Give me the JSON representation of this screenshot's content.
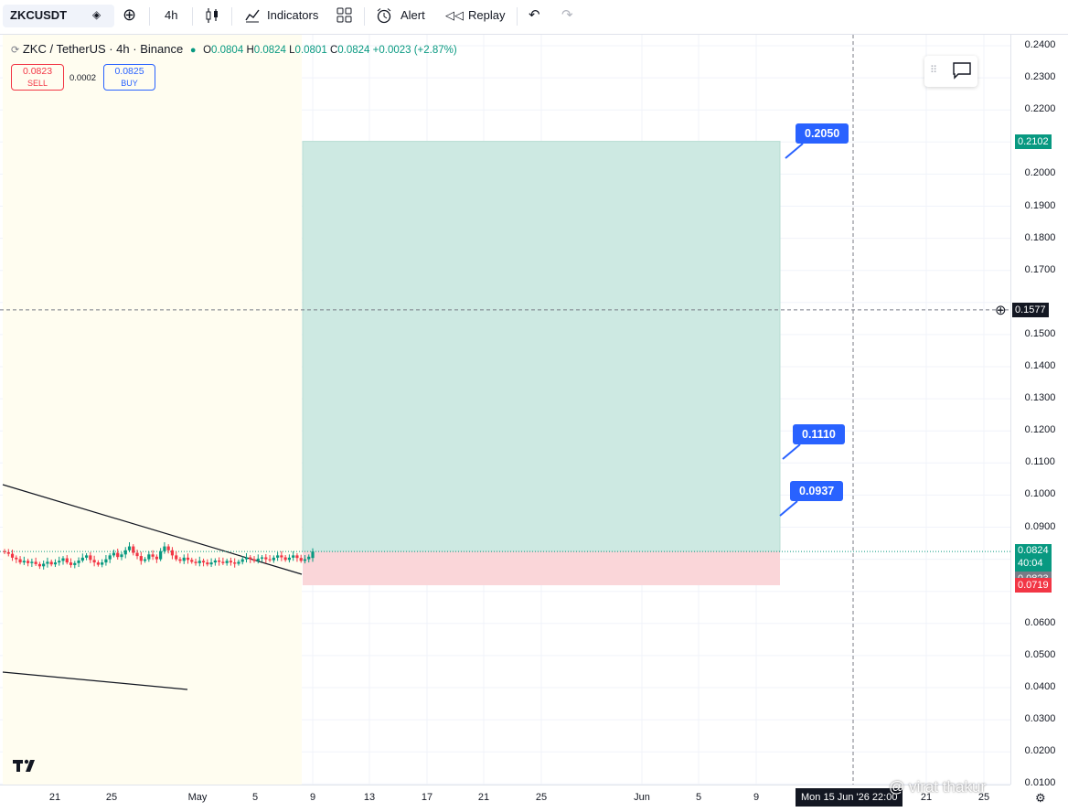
{
  "toolbar": {
    "symbol": "ZKCUSDT",
    "interval": "4h",
    "indicators_label": "Indicators",
    "alert_label": "Alert",
    "replay_label": "Replay"
  },
  "legend": {
    "title": "ZKC / TetherUS · 4h · Binance",
    "open_label": "O",
    "open": "0.0804",
    "high_label": "H",
    "high": "0.0824",
    "low_label": "L",
    "low": "0.0801",
    "close_label": "C",
    "close": "0.0824",
    "change": "+0.0023 (+2.87%)",
    "sell_price": "0.0823",
    "sell_label": "SELL",
    "spread": "0.0002",
    "buy_price": "0.0825",
    "buy_label": "BUY"
  },
  "annotations": {
    "target": "0.2050",
    "mid": "0.1110",
    "low": "0.0937"
  },
  "price_axis": {
    "ticks": [
      "0.2400",
      "0.2300",
      "0.2200",
      "0.2000",
      "0.1900",
      "0.1800",
      "0.1700",
      "0.1500",
      "0.1400",
      "0.1300",
      "0.1200",
      "0.1100",
      "0.1000",
      "0.0900",
      "0.0600",
      "0.0500",
      "0.0400",
      "0.0300",
      "0.0200",
      "0.0100"
    ],
    "tag_target": "0.2102",
    "tag_crosshair": "0.1577",
    "tag_last": "0.0824",
    "tag_countdown": "40:04",
    "tag_bid": "0.0823",
    "tag_stop": "0.0719"
  },
  "time_axis": {
    "labels": [
      "21",
      "25",
      "May",
      "5",
      "9",
      "13",
      "17",
      "21",
      "25",
      "Jun",
      "5",
      "9",
      "21",
      "25"
    ],
    "crosshair": "Mon 15 Jun '26   22:00"
  },
  "watermark": "@ virat thakur",
  "colors": {
    "profit_zone": "#cde9e2",
    "loss_zone": "#fad6d9",
    "accent": "#2962ff",
    "up": "#089981",
    "down": "#f23645"
  },
  "chart_data": {
    "type": "candlestick",
    "symbol": "ZKCUSDT",
    "interval": "4h",
    "ylim": [
      0.01,
      0.245
    ],
    "last_price": 0.0824,
    "position": {
      "entry": 0.0824,
      "target": 0.2102,
      "stop": 0.0719
    },
    "ohlc_last": {
      "open": 0.0804,
      "high": 0.0824,
      "low": 0.0801,
      "close": 0.0824
    },
    "closes": [
      0.0822,
      0.0817,
      0.0805,
      0.08,
      0.079,
      0.0795,
      0.0788,
      0.0792,
      0.0785,
      0.0778,
      0.0786,
      0.0792,
      0.0784,
      0.079,
      0.0795,
      0.0803,
      0.079,
      0.0782,
      0.0788,
      0.0796,
      0.0805,
      0.0812,
      0.0798,
      0.079,
      0.0783,
      0.079,
      0.08,
      0.0812,
      0.082,
      0.0807,
      0.0815,
      0.0828,
      0.084,
      0.082,
      0.081,
      0.0795,
      0.08,
      0.0815,
      0.0808,
      0.08,
      0.0825,
      0.084,
      0.0828,
      0.0812,
      0.08,
      0.0795,
      0.0805,
      0.0798,
      0.0792,
      0.0788,
      0.0795,
      0.079,
      0.0784,
      0.079,
      0.0796,
      0.0792,
      0.0788,
      0.0795,
      0.079,
      0.0786,
      0.0792,
      0.08,
      0.0806,
      0.08,
      0.0795,
      0.0802,
      0.0806,
      0.08,
      0.0797,
      0.0805,
      0.0812,
      0.0806,
      0.0798,
      0.0805,
      0.0812,
      0.0804,
      0.0795,
      0.08,
      0.0808,
      0.0824
    ]
  }
}
